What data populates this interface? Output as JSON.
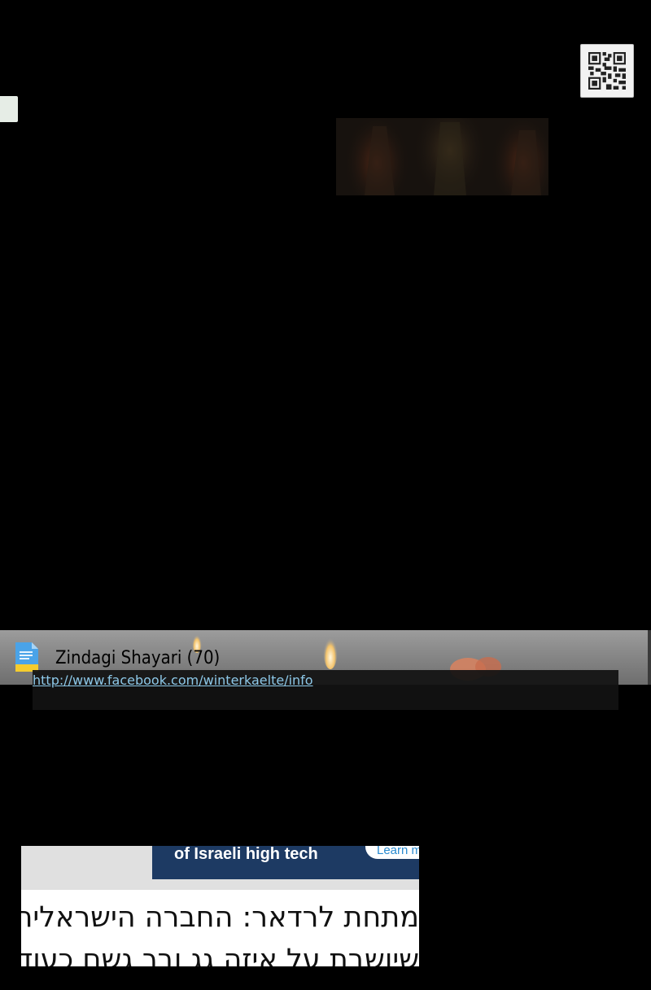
{
  "qr_button": {
    "icon": "qr-code-icon"
  },
  "wallpaper_entry": {
    "icon": "document-icon",
    "title": "Zindagi Shayari (70)",
    "url": "http://www.facebook.com/winterkaelte/info"
  },
  "news_card": {
    "ad_banner_text": "of Israeli high tech",
    "ad_banner_cta": "Learn m",
    "headline": "מתחת לרדאר: החברה הישראלית",
    "subline": "שיושבת על איזה גג ובך גשם כעוד"
  },
  "colors": {
    "background": "#000000",
    "link": "#8dc8e8",
    "banner": "#1d3a63"
  }
}
